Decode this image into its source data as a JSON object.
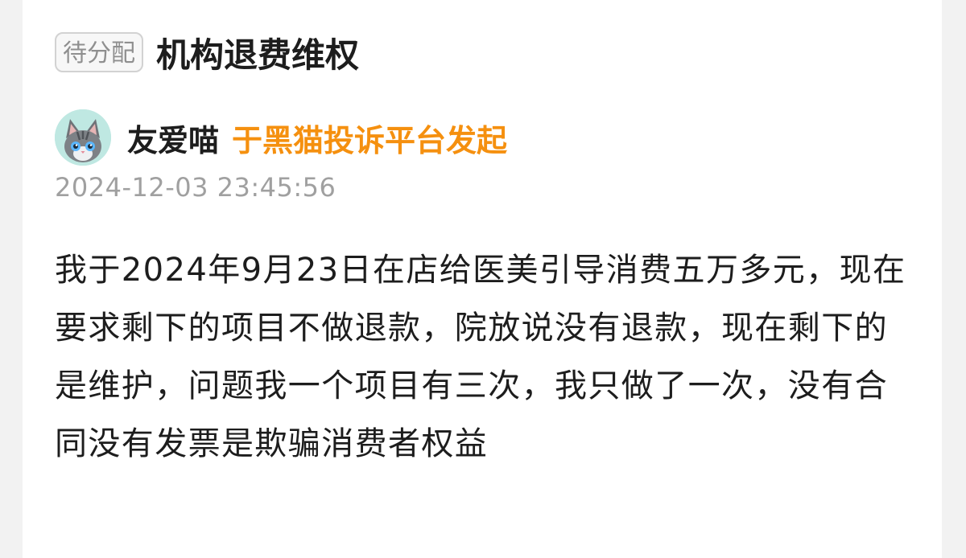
{
  "complaint": {
    "status_badge": "待分配",
    "title": "机构退费维权",
    "author": {
      "name": "友爱喵",
      "avatar_icon": "cat-avatar-icon",
      "source": "于黑猫投诉平台发起"
    },
    "timestamp": "2024-12-03 23:45:56",
    "body": "我于2024年9月23日在店给医美引导消费五万多元，现在要求剩下的项目不做退款，院放说没有退款，现在剩下的是维护，问题我一个项目有三次，我只做了一次，没有合同没有发票是欺骗消费者权益"
  },
  "colors": {
    "accent_orange": "#f5900f",
    "title_text": "#1d1d1d",
    "muted_text": "#a0a0a0",
    "badge_border": "#d2d2d2",
    "avatar_background": "#bfe8e2"
  }
}
